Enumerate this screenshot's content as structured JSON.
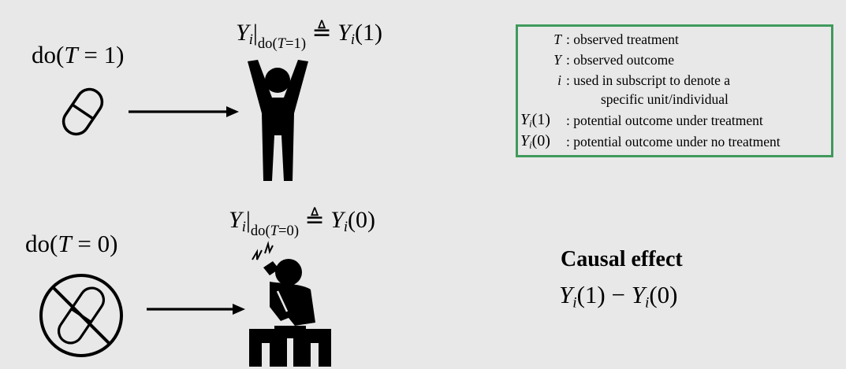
{
  "treat": {
    "do_label": {
      "do": "do",
      "open": "(",
      "var": "T",
      "rel": " = ",
      "val": "1",
      "close": ")"
    },
    "eq": {
      "Y": "Y",
      "i": "i",
      "bar": "|",
      "sub_do": "do",
      "sub_open": "(",
      "sub_var": "T",
      "sub_rel": "=",
      "sub_val": "1",
      "sub_close": ")",
      "defeq": "≜",
      "rhs_Y": "Y",
      "rhs_i": "i",
      "rhs_arg": "(1)"
    }
  },
  "control": {
    "do_label": {
      "do": "do",
      "open": "(",
      "var": "T",
      "rel": " = ",
      "val": "0",
      "close": ")"
    },
    "eq": {
      "Y": "Y",
      "i": "i",
      "bar": "|",
      "sub_do": "do",
      "sub_open": "(",
      "sub_var": "T",
      "sub_rel": "=",
      "sub_val": "0",
      "sub_close": ")",
      "defeq": "≜",
      "rhs_Y": "Y",
      "rhs_i": "i",
      "rhs_arg": "(0)"
    }
  },
  "legend": {
    "border_color": "#3f9a5c",
    "rows": [
      {
        "sym": "T",
        "desc": ": observed treatment"
      },
      {
        "sym": "Y",
        "desc": ": observed outcome"
      },
      {
        "sym": "i",
        "desc": ": used in subscript to denote a"
      },
      {
        "sym": "",
        "desc": "specific unit/individual"
      },
      {
        "sym_Y": "Y",
        "sym_i": "i",
        "sym_arg": "(1)",
        "desc": ": potential outcome under treatment"
      },
      {
        "sym_Y": "Y",
        "sym_i": "i",
        "sym_arg": "(0)",
        "desc": ": potential outcome under no treatment"
      }
    ]
  },
  "effect": {
    "title": "Causal effect",
    "Y1": "Y",
    "i1": "i",
    "arg1": "(1)",
    "minus": " − ",
    "Y2": "Y",
    "i2": "i",
    "arg2": "(0)"
  },
  "icons": {
    "pill": "pill-icon",
    "no_pill": "no-pill-icon",
    "happy_person": "happy-person-icon",
    "sad_person": "sad-person-icon",
    "arrow": "right-arrow-icon"
  }
}
